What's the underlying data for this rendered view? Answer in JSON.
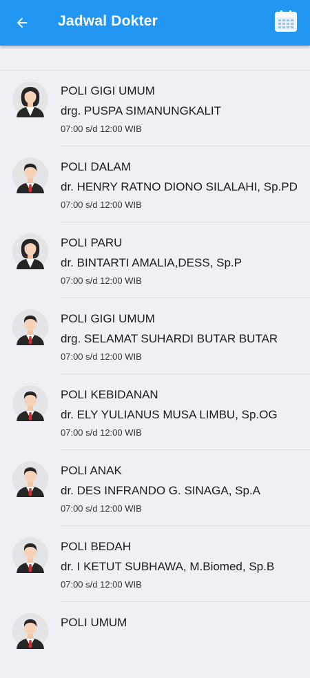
{
  "header": {
    "title": "Jadwal Dokter",
    "back_icon": "arrow-left-icon",
    "calendar_icon": "calendar-icon",
    "bar_color": "#2196f3"
  },
  "doctors": [
    {
      "poli": "POLI GIGI UMUM",
      "name": "drg. PUSPA SIMANUNGKALIT",
      "time": "07:00 s/d 12:00 WIB",
      "avatar": "female-doctor-avatar"
    },
    {
      "poli": "POLI DALAM",
      "name": "dr. HENRY RATNO DIONO SILALAHI, Sp.PD",
      "time": "07:00 s/d 12:00 WIB",
      "avatar": "male-doctor-avatar"
    },
    {
      "poli": "POLI PARU",
      "name": "dr. BINTARTI AMALIA,DESS, Sp.P",
      "time": "07:00 s/d 12:00 WIB",
      "avatar": "female-doctor-avatar"
    },
    {
      "poli": "POLI GIGI UMUM",
      "name": "drg. SELAMAT SUHARDI BUTAR BUTAR",
      "time": "07:00 s/d 12:00 WIB",
      "avatar": "male-doctor-avatar"
    },
    {
      "poli": "POLI KEBIDANAN",
      "name": "dr. ELY YULIANUS MUSA LIMBU, Sp.OG",
      "time": "07:00 s/d 12:00 WIB",
      "avatar": "male-doctor-avatar"
    },
    {
      "poli": "POLI ANAK",
      "name": "dr. DES INFRANDO G. SINAGA, Sp.A",
      "time": "07:00 s/d 12:00 WIB",
      "avatar": "male-doctor-avatar"
    },
    {
      "poli": "POLI BEDAH",
      "name": "dr. I KETUT SUBHAWA, M.Biomed, Sp.B",
      "time": "07:00 s/d 12:00 WIB",
      "avatar": "male-doctor-avatar"
    },
    {
      "poli": "POLI UMUM",
      "name": "",
      "time": "",
      "avatar": "male-doctor-avatar"
    }
  ]
}
